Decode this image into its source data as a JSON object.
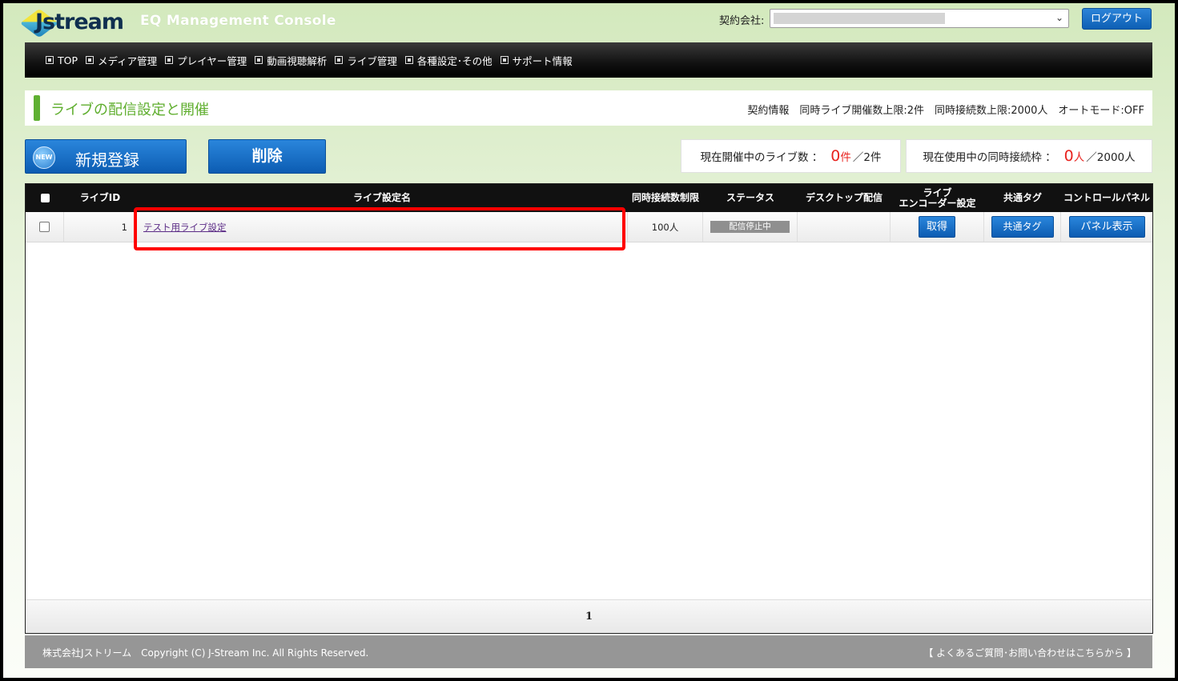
{
  "header": {
    "logo_text": "Jstream",
    "console_title": "EQ Management Console",
    "contract_label": "契約会社:",
    "logout_label": "ログアウト"
  },
  "nav": [
    {
      "label": "TOP"
    },
    {
      "label": "メディア管理"
    },
    {
      "label": "プレイヤー管理"
    },
    {
      "label": "動画視聴解析"
    },
    {
      "label": "ライブ管理"
    },
    {
      "label": "各種設定･その他"
    },
    {
      "label": "サポート情報"
    }
  ],
  "page": {
    "title": "ライブの配信設定と開催",
    "contract_info": "契約情報　同時ライブ開催数上限:2件　同時接続数上限:2000人　オートモード:OFF"
  },
  "actions": {
    "new_badge": "NEW",
    "new_label": "新規登録",
    "delete_label": "削除"
  },
  "stats": {
    "live_label": "現在開催中のライブ数 ：",
    "live_current": "0",
    "live_unit": "件",
    "live_max": "／2件",
    "conn_label": "現在使用中の同時接続枠 ：",
    "conn_current": "0",
    "conn_unit": "人",
    "conn_max": "／2000人"
  },
  "table": {
    "headers": {
      "id": "ライブID",
      "name": "ライブ設定名",
      "limit": "同時接続数制限",
      "status": "ステータス",
      "desktop": "デスクトップ配信",
      "encoder_line1": "ライブ",
      "encoder_line2": "エンコーダー設定",
      "tag": "共通タグ",
      "panel": "コントロールパネル"
    },
    "rows": [
      {
        "id": "1",
        "name": "テスト用ライブ設定",
        "limit": "100人",
        "status": "配信停止中",
        "desktop": "",
        "encoder_btn": "取得",
        "tag_btn": "共通タグ",
        "panel_btn": "パネル表示"
      }
    ],
    "page_number": "1"
  },
  "footer": {
    "copyright": "株式会社Jストリーム　Copyright (C) J-Stream Inc. All Rights Reserved.",
    "faq_link": "【 よくあるご質問･お問い合わせはこちらから 】"
  },
  "colors": {
    "accent_green": "#5fae2e",
    "primary_blue": "#0c5cb2",
    "highlight_red": "#ff0000",
    "counter_red": "#e8231f"
  }
}
